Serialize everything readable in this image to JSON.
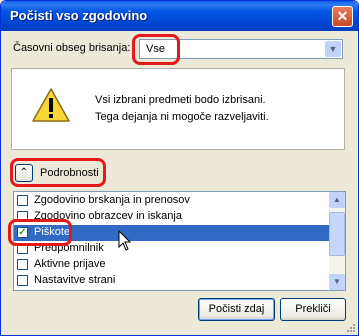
{
  "window": {
    "title": "Počisti vso zgodovino",
    "close_glyph": "✕"
  },
  "range": {
    "label": "Časovni obseg brisanja:",
    "value": "Vse",
    "arrow": "▼"
  },
  "warning": {
    "icon": "warning-triangle-icon",
    "line1": "Vsi izbrani predmeti bodo izbrisani.",
    "line2": "Tega dejanja ni mogoče razveljaviti."
  },
  "details": {
    "label": "Podrobnosti",
    "toggle_glyph": "⌃"
  },
  "items": [
    {
      "label": "Zgodovino brskanja in prenosov",
      "checked": false,
      "selected": false
    },
    {
      "label": "Zgodovino obrazcev in iskanja",
      "checked": false,
      "selected": false
    },
    {
      "label": "Piškote",
      "checked": true,
      "selected": true
    },
    {
      "label": "Predpomnilnik",
      "checked": false,
      "selected": false
    },
    {
      "label": "Aktivne prijave",
      "checked": false,
      "selected": false
    },
    {
      "label": "Nastavitve strani",
      "checked": false,
      "selected": false
    }
  ],
  "scrollbar": {
    "up": "▲",
    "down": "▼"
  },
  "buttons": {
    "clear": "Počisti zdaj",
    "cancel": "Prekliči"
  },
  "colors": {
    "titlebar": "#0055e5",
    "selection": "#316ac5",
    "highlight": "#e41919"
  }
}
